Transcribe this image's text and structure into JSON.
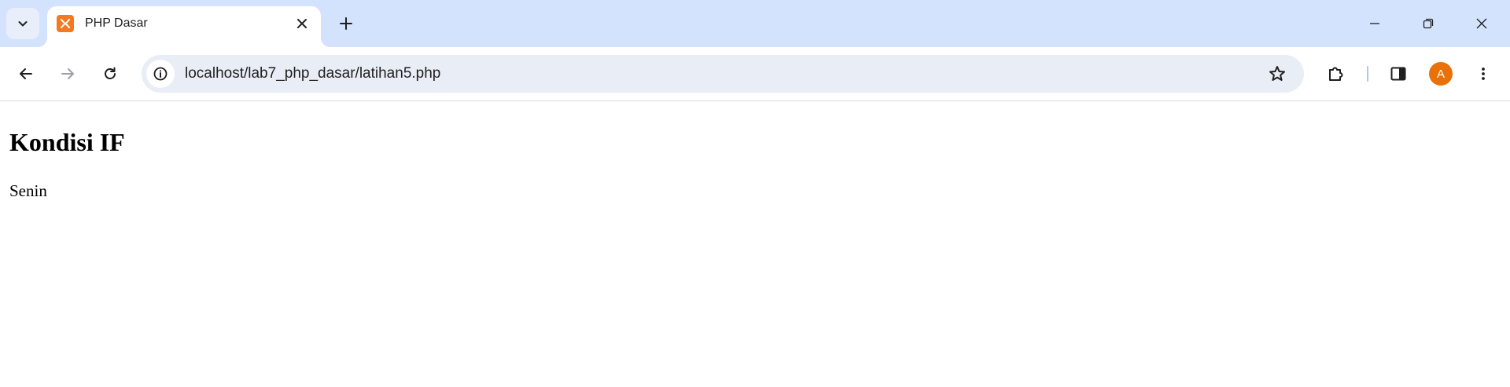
{
  "browser": {
    "tab": {
      "title": "PHP Dasar",
      "favicon": "xampp-icon"
    },
    "address_bar": {
      "url": "localhost/lab7_php_dasar/latihan5.php"
    },
    "profile": {
      "initial": "A",
      "color": "#e8710a"
    },
    "colors": {
      "tabstrip": "#d3e3fd",
      "omnibox": "#e9eef6"
    },
    "icons": {
      "tab_search": "chevron-down-icon",
      "close_tab": "close-icon",
      "new_tab": "plus-icon",
      "minimize": "minimize-icon",
      "restore": "restore-icon",
      "close_window": "close-icon",
      "back": "arrow-left-icon",
      "forward": "arrow-right-icon",
      "reload": "reload-icon",
      "site_info": "info-icon",
      "bookmark": "star-icon",
      "extensions": "puzzle-icon",
      "side_panel": "side-panel-icon",
      "menu": "more-vert-icon"
    }
  },
  "page": {
    "heading": "Kondisi IF",
    "text": "Senin"
  }
}
